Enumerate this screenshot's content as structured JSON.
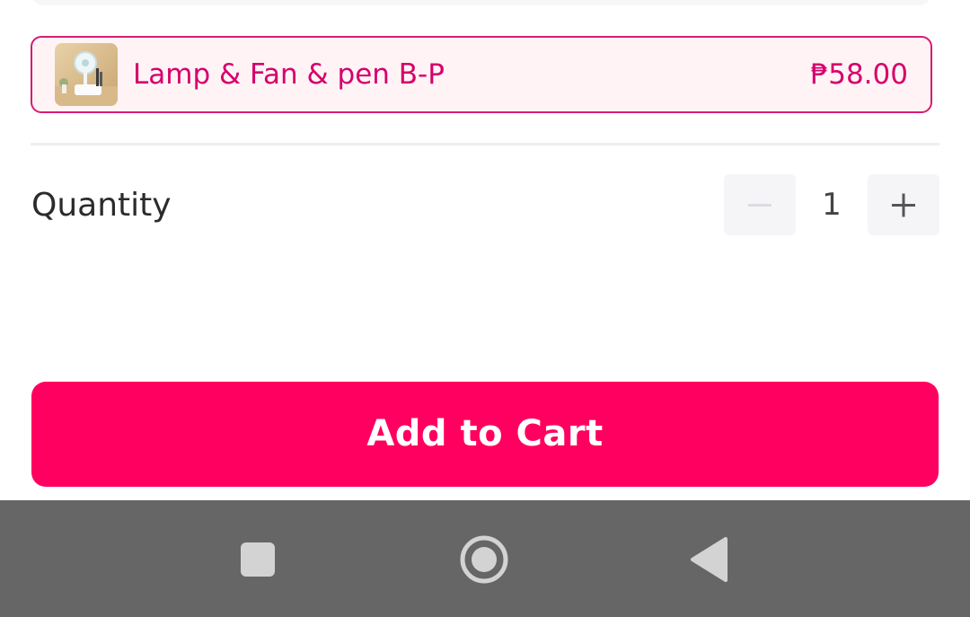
{
  "variant": {
    "name": "Lamp & Fan & pen B-P",
    "price": "₱58.00",
    "thumbnail_icon": "lamp-fan-pen-product-image",
    "selected": true
  },
  "quantity": {
    "label": "Quantity",
    "value": "1",
    "decrement_icon": "minus-icon",
    "increment_icon": "plus-icon"
  },
  "cta": {
    "add_to_cart_label": "Add to Cart"
  },
  "navigation": {
    "recents_icon": "square-icon",
    "home_icon": "circle-icon",
    "back_icon": "triangle-back-icon"
  },
  "colors": {
    "accent": "#ff0060",
    "selected_border": "#d81b74",
    "selected_text": "#d6006b",
    "selected_background": "#fff3f6",
    "nav_bar": "#666666"
  }
}
